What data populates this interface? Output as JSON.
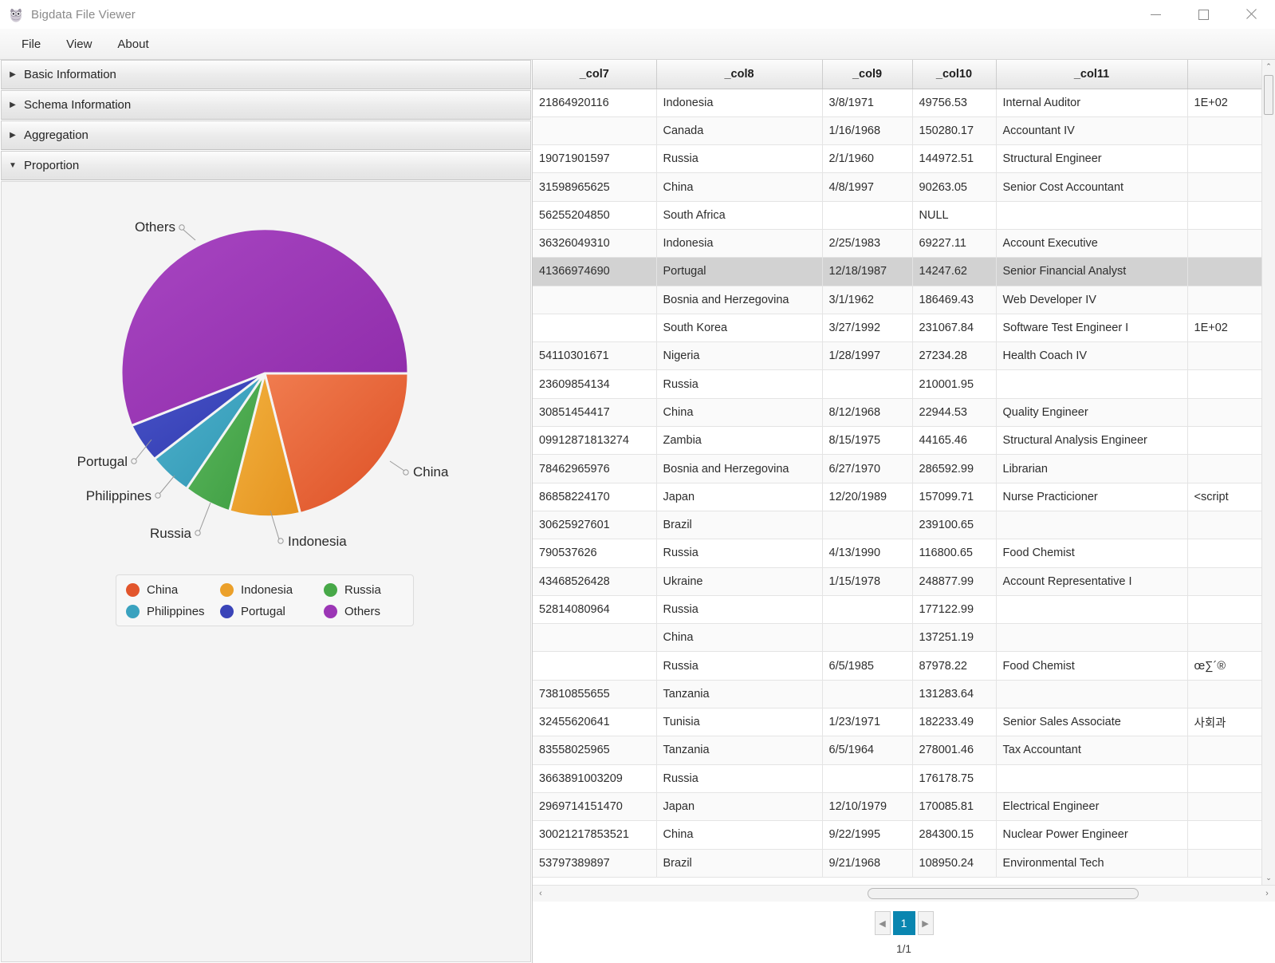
{
  "window": {
    "title": "Bigdata File Viewer",
    "icon": "owl-icon",
    "minimize_label": "–",
    "maximize_label": "□",
    "close_label": "✕"
  },
  "menubar": {
    "items": [
      "File",
      "View",
      "About"
    ]
  },
  "accordion": {
    "sections": [
      {
        "label": "Basic Information",
        "expanded": false,
        "arrow": "▶"
      },
      {
        "label": "Schema Information",
        "expanded": false,
        "arrow": "▶"
      },
      {
        "label": "Aggregation",
        "expanded": false,
        "arrow": "▶"
      },
      {
        "label": "Proportion",
        "expanded": true,
        "arrow": "▼"
      }
    ]
  },
  "chart_data": {
    "type": "pie",
    "title": "",
    "legend_position": "bottom",
    "labels": [
      "China",
      "Indonesia",
      "Russia",
      "Philippines",
      "Portugal",
      "Others"
    ],
    "values": [
      16.9,
      9.2,
      5.3,
      4.4,
      3.9,
      60.3
    ],
    "colors": [
      "#e2552c",
      "#eba02a",
      "#47a848",
      "#3aa2bf",
      "#3a44b8",
      "#9b36b5"
    ],
    "callout_labels": [
      "Others",
      "China",
      "Indonesia",
      "Russia",
      "Philippines",
      "Portugal"
    ],
    "legend_entries": [
      {
        "label": "China",
        "color": "#e2552c"
      },
      {
        "label": "Indonesia",
        "color": "#eba02a"
      },
      {
        "label": "Russia",
        "color": "#47a848"
      },
      {
        "label": "Philippines",
        "color": "#3aa2bf"
      },
      {
        "label": "Portugal",
        "color": "#3a44b8"
      },
      {
        "label": "Others",
        "color": "#9b36b5"
      }
    ]
  },
  "table": {
    "columns": [
      "_col7",
      "_col8",
      "_col9",
      "_col10",
      "_col11",
      ""
    ],
    "selected_row_index": 6,
    "rows": [
      [
        "21864920116",
        "Indonesia",
        "3/8/1971",
        "49756.53",
        "Internal Auditor",
        "1E+02"
      ],
      [
        "",
        "Canada",
        "1/16/1968",
        "150280.17",
        "Accountant IV",
        ""
      ],
      [
        "19071901597",
        "Russia",
        "2/1/1960",
        "144972.51",
        "Structural Engineer",
        ""
      ],
      [
        "31598965625",
        "China",
        "4/8/1997",
        "90263.05",
        "Senior Cost Accountant",
        ""
      ],
      [
        "56255204850",
        "South Africa",
        "",
        "NULL",
        "",
        ""
      ],
      [
        "36326049310",
        "Indonesia",
        "2/25/1983",
        "69227.11",
        "Account Executive",
        ""
      ],
      [
        "41366974690",
        "Portugal",
        "12/18/1987",
        "14247.62",
        "Senior Financial Analyst",
        ""
      ],
      [
        "",
        "Bosnia and Herzegovina",
        "3/1/1962",
        "186469.43",
        "Web Developer IV",
        ""
      ],
      [
        "",
        "South Korea",
        "3/27/1992",
        "231067.84",
        "Software Test Engineer I",
        "1E+02"
      ],
      [
        "54110301671",
        "Nigeria",
        "1/28/1997",
        "27234.28",
        "Health Coach IV",
        ""
      ],
      [
        "23609854134",
        "Russia",
        "",
        "210001.95",
        "",
        ""
      ],
      [
        "30851454417",
        "China",
        "8/12/1968",
        "22944.53",
        "Quality Engineer",
        ""
      ],
      [
        "09912871813274",
        "Zambia",
        "8/15/1975",
        "44165.46",
        "Structural Analysis Engineer",
        ""
      ],
      [
        "78462965976",
        "Bosnia and Herzegovina",
        "6/27/1970",
        "286592.99",
        "Librarian",
        ""
      ],
      [
        "86858224170",
        "Japan",
        "12/20/1989",
        "157099.71",
        "Nurse Practicioner",
        "<script"
      ],
      [
        "30625927601",
        "Brazil",
        "",
        "239100.65",
        "",
        ""
      ],
      [
        "790537626",
        "Russia",
        "4/13/1990",
        "116800.65",
        "Food Chemist",
        ""
      ],
      [
        "43468526428",
        "Ukraine",
        "1/15/1978",
        "248877.99",
        "Account Representative I",
        ""
      ],
      [
        "52814080964",
        "Russia",
        "",
        "177122.99",
        "",
        ""
      ],
      [
        "",
        "China",
        "",
        "137251.19",
        "",
        ""
      ],
      [
        "",
        "Russia",
        "6/5/1985",
        "87978.22",
        "Food Chemist",
        "œ∑´®"
      ],
      [
        "73810855655",
        "Tanzania",
        "",
        "131283.64",
        "",
        ""
      ],
      [
        "32455620641",
        "Tunisia",
        "1/23/1971",
        "182233.49",
        "Senior Sales Associate",
        "사회과"
      ],
      [
        "83558025965",
        "Tanzania",
        "6/5/1964",
        "278001.46",
        "Tax Accountant",
        ""
      ],
      [
        "3663891003209",
        "Russia",
        "",
        "176178.75",
        "",
        ""
      ],
      [
        "2969714151470",
        "Japan",
        "12/10/1979",
        "170085.81",
        "Electrical Engineer",
        ""
      ],
      [
        "30021217853521",
        "China",
        "9/22/1995",
        "284300.15",
        "Nuclear Power Engineer",
        ""
      ],
      [
        "53797389897",
        "Brazil",
        "9/21/1968",
        "108950.24",
        "Environmental Tech",
        ""
      ]
    ]
  },
  "scrollbars": {
    "vertical_up": "⌃",
    "vertical_down": "⌄",
    "horizontal_left": "‹",
    "horizontal_right": "›"
  },
  "pagination": {
    "prev_label": "◀",
    "next_label": "▶",
    "current_page": "1",
    "page_info": "1/1"
  }
}
